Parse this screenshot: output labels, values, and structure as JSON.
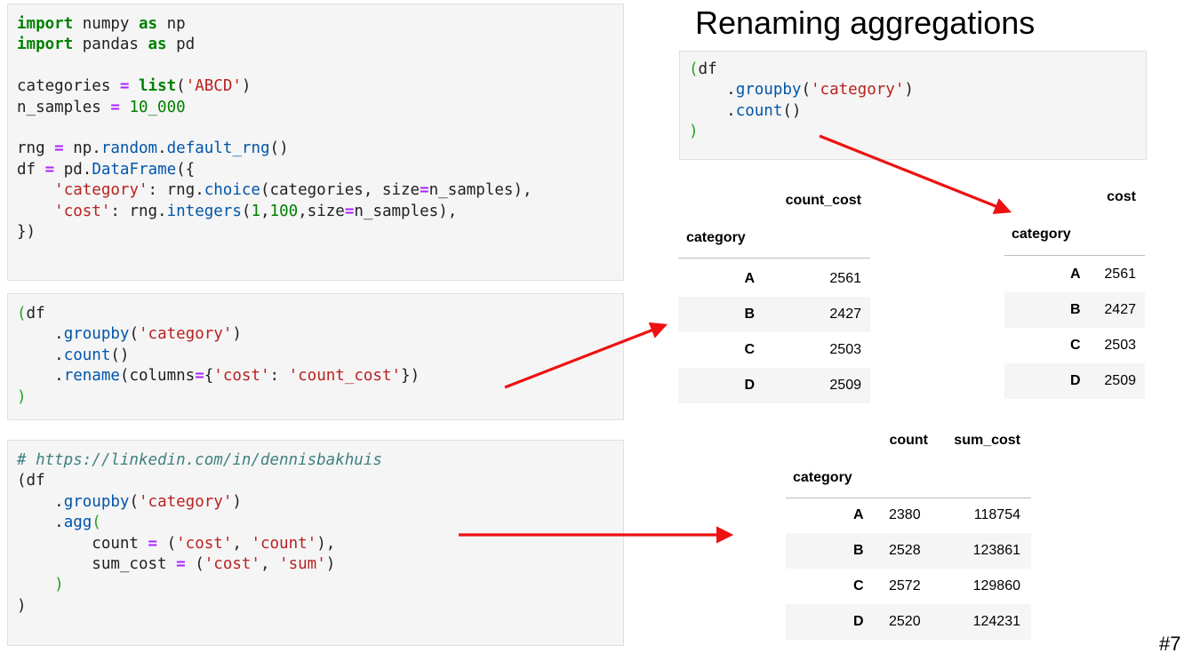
{
  "title": "Renaming aggregations",
  "slide_number": "#7",
  "code_cells": {
    "setup": [
      [
        {
          "t": "import",
          "c": "kw"
        },
        {
          "t": " numpy "
        },
        {
          "t": "as",
          "c": "kw"
        },
        {
          "t": " np"
        }
      ],
      [
        {
          "t": "import",
          "c": "kw"
        },
        {
          "t": " pandas "
        },
        {
          "t": "as",
          "c": "kw"
        },
        {
          "t": " pd"
        }
      ],
      [],
      [
        {
          "t": "categories "
        },
        {
          "t": "=",
          "c": "op"
        },
        {
          "t": " "
        },
        {
          "t": "list",
          "c": "kw"
        },
        {
          "t": "("
        },
        {
          "t": "'ABCD'",
          "c": "str"
        },
        {
          "t": ")"
        }
      ],
      [
        {
          "t": "n_samples "
        },
        {
          "t": "=",
          "c": "op"
        },
        {
          "t": " "
        },
        {
          "t": "10_000",
          "c": "num"
        }
      ],
      [],
      [
        {
          "t": "rng "
        },
        {
          "t": "=",
          "c": "op"
        },
        {
          "t": " np."
        },
        {
          "t": "random",
          "c": "fn"
        },
        {
          "t": "."
        },
        {
          "t": "default_rng",
          "c": "fn"
        },
        {
          "t": "()"
        }
      ],
      [
        {
          "t": "df "
        },
        {
          "t": "=",
          "c": "op"
        },
        {
          "t": " pd."
        },
        {
          "t": "DataFrame",
          "c": "fn"
        },
        {
          "t": "({"
        }
      ],
      [
        {
          "t": "    "
        },
        {
          "t": "'category'",
          "c": "str"
        },
        {
          "t": ": rng."
        },
        {
          "t": "choice",
          "c": "fn"
        },
        {
          "t": "(categories, size"
        },
        {
          "t": "=",
          "c": "op"
        },
        {
          "t": "n_samples),"
        }
      ],
      [
        {
          "t": "    "
        },
        {
          "t": "'cost'",
          "c": "str"
        },
        {
          "t": ": rng."
        },
        {
          "t": "integers",
          "c": "fn"
        },
        {
          "t": "("
        },
        {
          "t": "1",
          "c": "num"
        },
        {
          "t": ","
        },
        {
          "t": "100",
          "c": "num"
        },
        {
          "t": ",size"
        },
        {
          "t": "=",
          "c": "op"
        },
        {
          "t": "n_samples),"
        }
      ],
      [
        {
          "t": "})"
        }
      ]
    ],
    "rename": [
      [
        {
          "t": "(",
          "c": "par"
        },
        {
          "t": "df"
        }
      ],
      [
        {
          "t": "    ."
        },
        {
          "t": "groupby",
          "c": "fn"
        },
        {
          "t": "("
        },
        {
          "t": "'category'",
          "c": "str"
        },
        {
          "t": ")"
        }
      ],
      [
        {
          "t": "    ."
        },
        {
          "t": "count",
          "c": "fn"
        },
        {
          "t": "()"
        }
      ],
      [
        {
          "t": "    ."
        },
        {
          "t": "rename",
          "c": "fn"
        },
        {
          "t": "(columns"
        },
        {
          "t": "=",
          "c": "op"
        },
        {
          "t": "{"
        },
        {
          "t": "'cost'",
          "c": "str"
        },
        {
          "t": ": "
        },
        {
          "t": "'count_cost'",
          "c": "str"
        },
        {
          "t": "})"
        }
      ],
      [
        {
          "t": ")",
          "c": "par"
        }
      ]
    ],
    "agg": [
      [
        {
          "t": "# https://linkedin.com/in/dennisbakhuis",
          "c": "cm"
        }
      ],
      [
        {
          "t": "(df"
        }
      ],
      [
        {
          "t": "    ."
        },
        {
          "t": "groupby",
          "c": "fn"
        },
        {
          "t": "("
        },
        {
          "t": "'category'",
          "c": "str"
        },
        {
          "t": ")"
        }
      ],
      [
        {
          "t": "    ."
        },
        {
          "t": "agg",
          "c": "fn"
        },
        {
          "t": "(",
          "c": "par"
        }
      ],
      [
        {
          "t": "        count "
        },
        {
          "t": "=",
          "c": "op"
        },
        {
          "t": " ("
        },
        {
          "t": "'cost'",
          "c": "str"
        },
        {
          "t": ", "
        },
        {
          "t": "'count'",
          "c": "str"
        },
        {
          "t": "),"
        }
      ],
      [
        {
          "t": "        sum_cost "
        },
        {
          "t": "=",
          "c": "op"
        },
        {
          "t": " ("
        },
        {
          "t": "'cost'",
          "c": "str"
        },
        {
          "t": ", "
        },
        {
          "t": "'sum'",
          "c": "str"
        },
        {
          "t": ")"
        }
      ],
      [
        {
          "t": "    "
        },
        {
          "t": ")",
          "c": "par"
        }
      ],
      [
        {
          "t": ")"
        }
      ]
    ],
    "count": [
      [
        {
          "t": "(",
          "c": "par"
        },
        {
          "t": "df"
        }
      ],
      [
        {
          "t": "    ."
        },
        {
          "t": "groupby",
          "c": "fn"
        },
        {
          "t": "("
        },
        {
          "t": "'category'",
          "c": "str"
        },
        {
          "t": ")"
        }
      ],
      [
        {
          "t": "    ."
        },
        {
          "t": "count",
          "c": "fn"
        },
        {
          "t": "()"
        }
      ],
      [
        {
          "t": ")",
          "c": "par"
        }
      ]
    ]
  },
  "tables": {
    "rename_result": {
      "columns": [
        "count_cost"
      ],
      "index_name": "category",
      "rows": [
        [
          "A",
          "2561"
        ],
        [
          "B",
          "2427"
        ],
        [
          "C",
          "2503"
        ],
        [
          "D",
          "2509"
        ]
      ]
    },
    "count_result": {
      "columns": [
        "cost"
      ],
      "index_name": "category",
      "rows": [
        [
          "A",
          "2561"
        ],
        [
          "B",
          "2427"
        ],
        [
          "C",
          "2503"
        ],
        [
          "D",
          "2509"
        ]
      ]
    },
    "agg_result": {
      "columns": [
        "count",
        "sum_cost"
      ],
      "index_name": "category",
      "rows": [
        [
          "A",
          "2380",
          "118754"
        ],
        [
          "B",
          "2528",
          "123861"
        ],
        [
          "C",
          "2572",
          "129860"
        ],
        [
          "D",
          "2520",
          "124231"
        ]
      ]
    }
  },
  "arrow_color": "#ee1111"
}
